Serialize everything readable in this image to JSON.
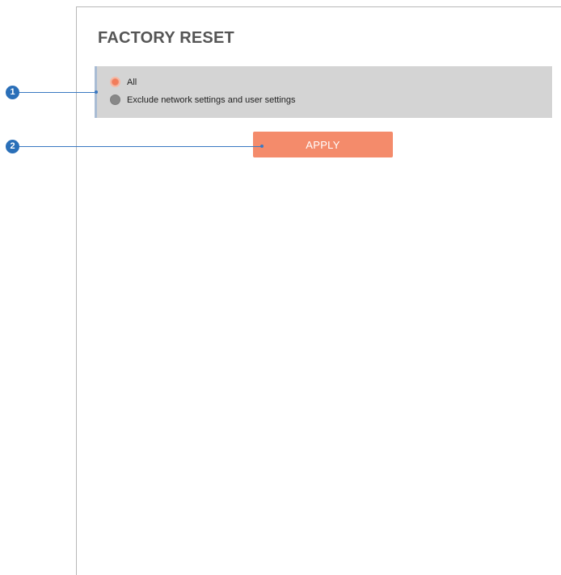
{
  "section": {
    "title": "FACTORY RESET"
  },
  "reset_options": {
    "items": [
      {
        "label": "All",
        "selected": true
      },
      {
        "label": "Exclude network settings and user settings",
        "selected": false
      }
    ]
  },
  "actions": {
    "apply_label": "APPLY"
  },
  "callouts": {
    "first": "1",
    "second": "2"
  },
  "colors": {
    "accent": "#f48b6b",
    "options_background": "#d4d4d4",
    "callout": "#2a6fb8",
    "title": "#555555"
  }
}
